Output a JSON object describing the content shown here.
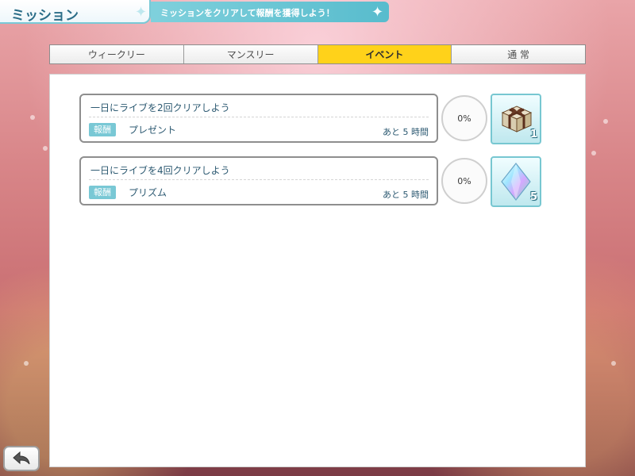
{
  "header": {
    "title": "ミッション",
    "subtitle": "ミッションをクリアして報酬を獲得しよう！"
  },
  "tabs": [
    {
      "label": "ウィークリー",
      "active": false
    },
    {
      "label": "マンスリー",
      "active": false
    },
    {
      "label": "イベント",
      "active": true
    },
    {
      "label": "通 常",
      "active": false
    }
  ],
  "missions": [
    {
      "title": "一日にライブを2回クリアしよう",
      "reward_badge": "報酬",
      "reward_name": "プレゼント",
      "remaining": "あと 5 時間",
      "progress": "0%",
      "reward_count": "1",
      "reward_icon": "gift-box-icon"
    },
    {
      "title": "一日にライブを4回クリアしよう",
      "reward_badge": "報酬",
      "reward_name": "プリズム",
      "remaining": "あと 5 時間",
      "progress": "0%",
      "reward_count": "5",
      "reward_icon": "prism-icon"
    }
  ],
  "colors": {
    "accent": "#79c8d5",
    "active_tab": "#ffd21a"
  },
  "back_button": {
    "icon": "back-arrow-icon"
  }
}
